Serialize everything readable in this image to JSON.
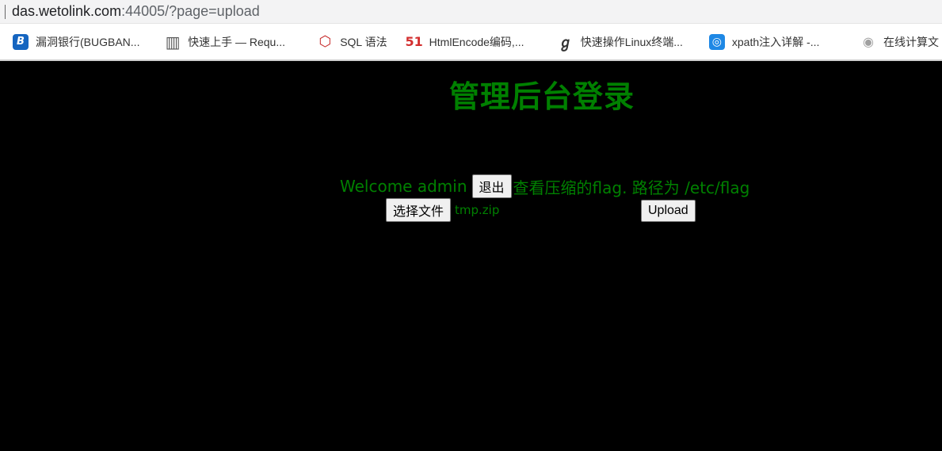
{
  "browser": {
    "url_host": "das.wetolink.com",
    "url_rest": ":44005/?page=upload",
    "bookmarks": [
      {
        "label": "漏洞银行(BUGBAN...",
        "icon": "bugbank-icon",
        "glyph": "B",
        "color": "#1565c0"
      },
      {
        "label": "快速上手 — Requ...",
        "icon": "document-columns-icon",
        "glyph": "▥",
        "color": "#555555"
      },
      {
        "label": "SQL 语法",
        "icon": "w3school-icon",
        "glyph": "⬡",
        "color": "#c62828"
      },
      {
        "label": "HtmlEncode编码,...",
        "icon": "51-icon",
        "glyph": "51",
        "color": "#d32f2f"
      },
      {
        "label": "快速操作Linux终端...",
        "icon": "linux-swirl-icon",
        "glyph": "ℊ",
        "color": "#333333"
      },
      {
        "label": "xpath注入详解 -...",
        "icon": "globe-icon",
        "glyph": "◎",
        "color": "#1e88e5"
      },
      {
        "label": "在线计算文",
        "icon": "calculator-icon",
        "glyph": "◉",
        "color": "#a0a0a0"
      }
    ]
  },
  "page": {
    "title": "管理后台登录",
    "welcome_text": "Welcome admin",
    "logout_label": "退出",
    "hint_text": "查看压缩的flag. 路径为 /etc/flag",
    "choose_file_label": "选择文件",
    "file_name": "tmp.zip",
    "upload_label": "Upload"
  },
  "colors": {
    "background": "#000000",
    "text_accent": "#008000"
  }
}
